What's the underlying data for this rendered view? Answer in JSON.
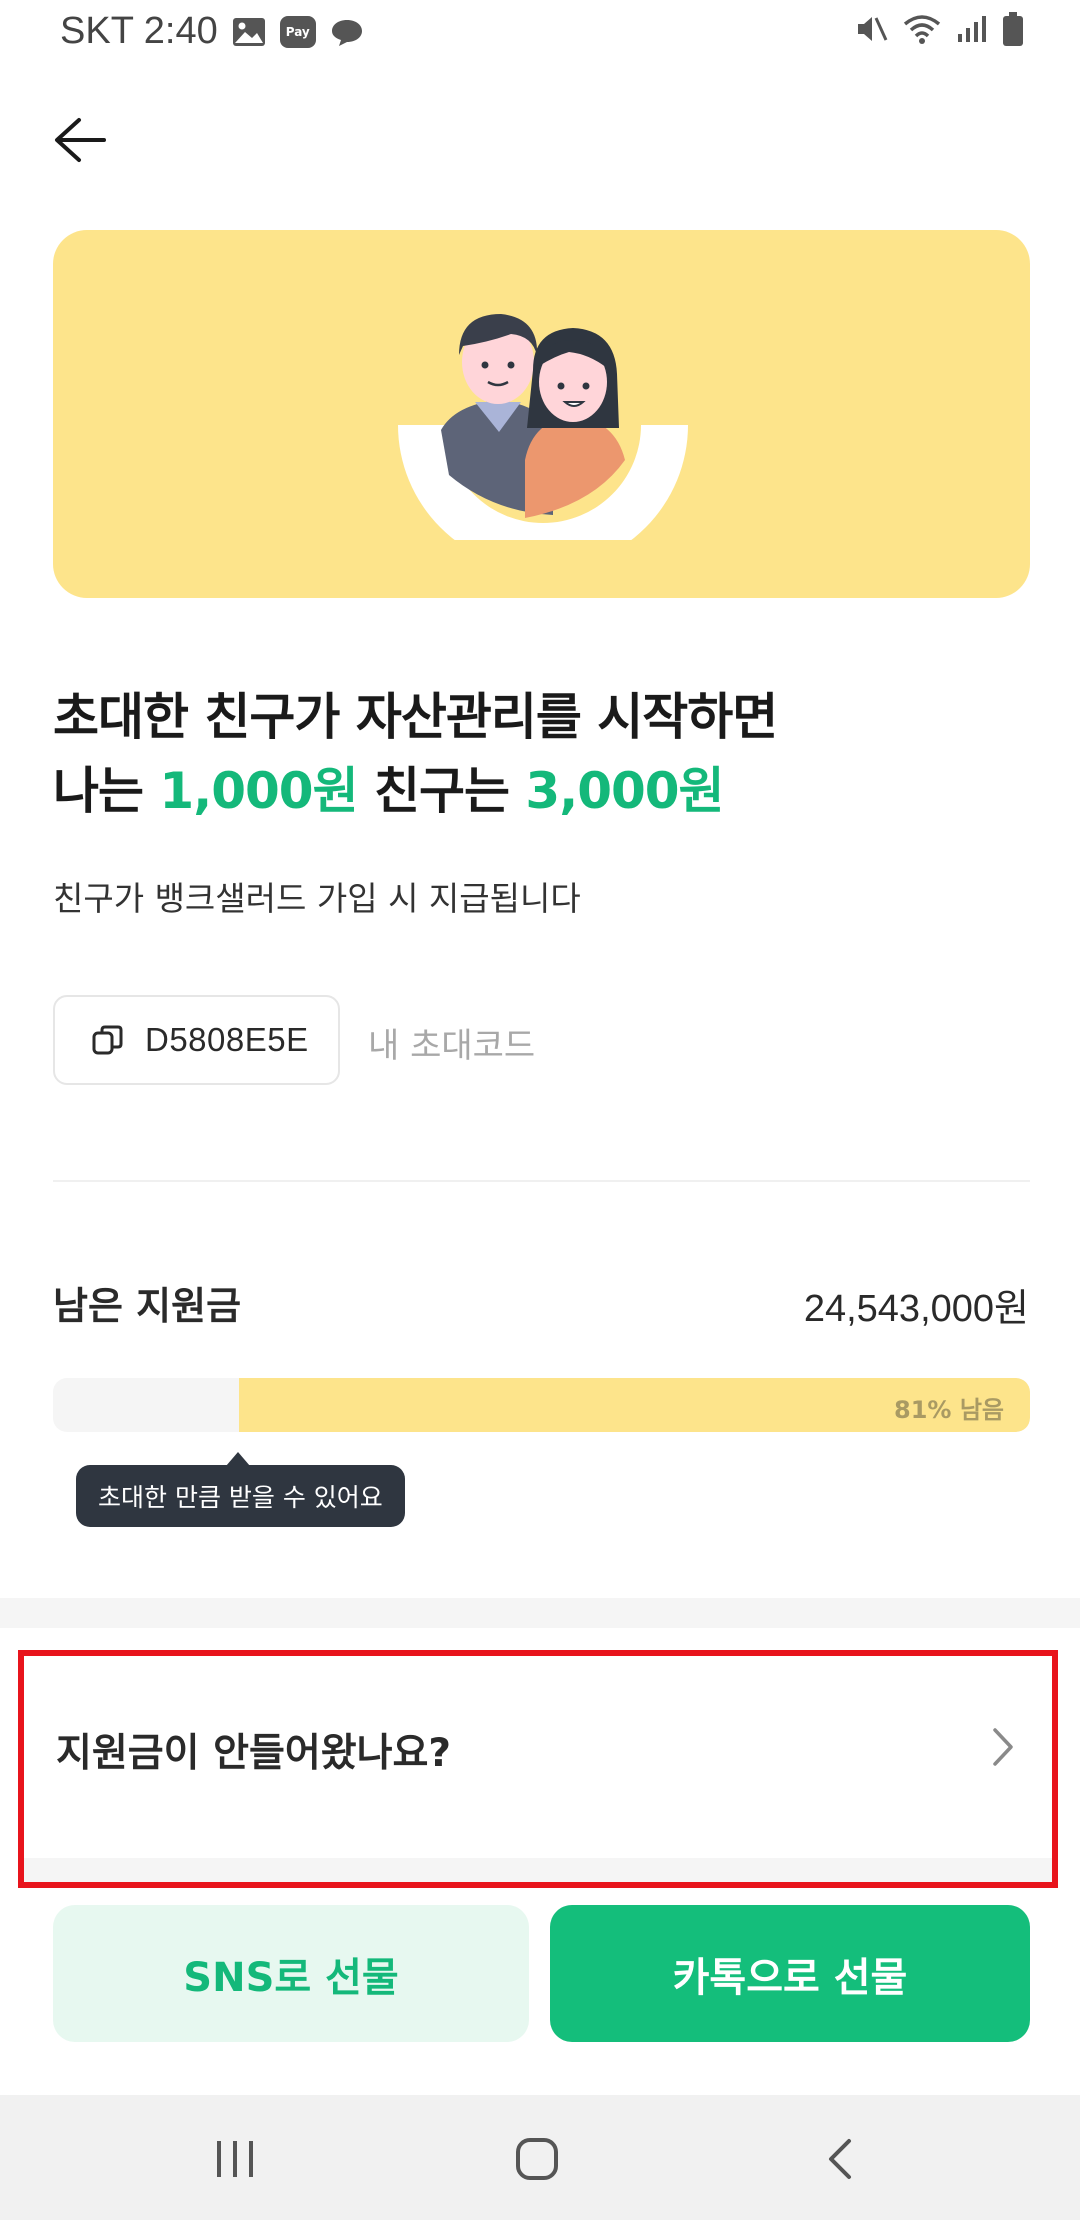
{
  "status_bar": {
    "carrier_time": "SKT 2:40",
    "pay_badge": "Pay",
    "icons": [
      "image-icon",
      "pay-icon",
      "chat-icon",
      "mute-icon",
      "wifi-icon",
      "signal-icon",
      "battery-icon"
    ]
  },
  "header": {
    "back_icon": "arrow-left-icon"
  },
  "headline": {
    "line1": "초대한 친구가 자산관리를 시작하면",
    "line2_prefix": "나는 ",
    "line2_amount1": "1,000원",
    "line2_mid": " 친구는 ",
    "line2_amount2": "3,000원"
  },
  "subtext": "친구가 뱅크샐러드 가입 시 지급됩니다",
  "invite": {
    "code": "D5808E5E",
    "label": "내 초대코드",
    "copy_icon": "copy-icon"
  },
  "support": {
    "label": "남은 지원금",
    "amount": "24,543,000원",
    "remaining_percent": 81,
    "progress_label": "81% 남음",
    "tooltip": "초대한 만큼 받을 수 있어요"
  },
  "faq": {
    "question": "지원금이 안들어왔나요?",
    "chevron_icon": "chevron-right-icon"
  },
  "actions": {
    "sns_label": "SNS로 선물",
    "kakao_label": "카톡으로 선물"
  },
  "colors": {
    "accent_green": "#14b87a",
    "hero_yellow": "#fde48b",
    "highlight_red": "#e8141c"
  }
}
